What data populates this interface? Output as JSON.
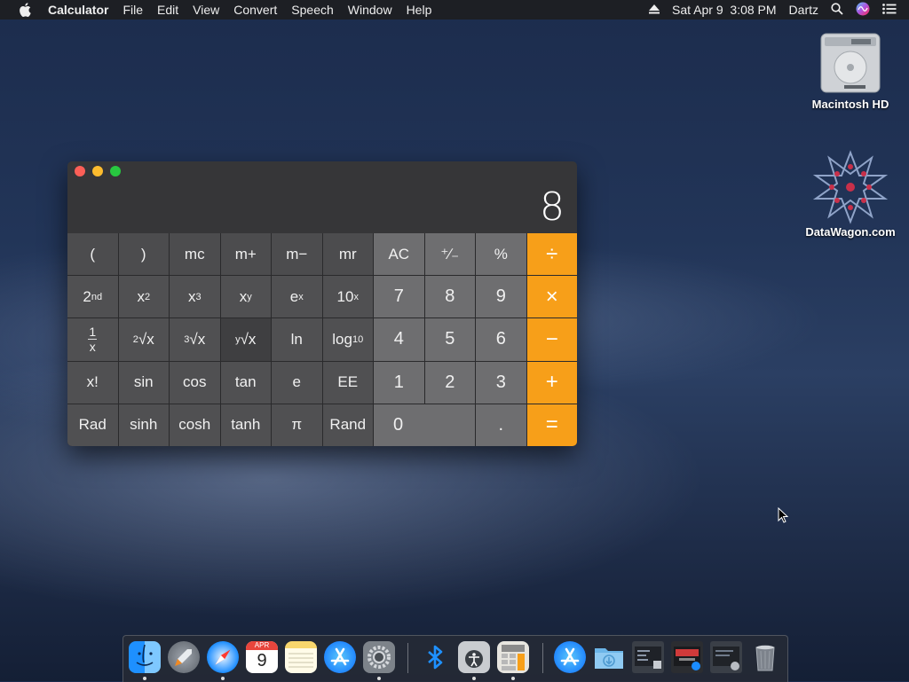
{
  "menubar": {
    "app_name": "Calculator",
    "menus": [
      "File",
      "Edit",
      "View",
      "Convert",
      "Speech",
      "Window",
      "Help"
    ],
    "datetime": "Sat Apr 9  3:08 PM",
    "user": "Dartz"
  },
  "desktop": {
    "icons": [
      {
        "label": "Macintosh HD",
        "icon": "hard-drive-icon"
      },
      {
        "label": "DataWagon.com",
        "icon": "datawagon-logo-icon"
      }
    ]
  },
  "calculator": {
    "display": "8",
    "keys": {
      "row1": [
        "(",
        ")",
        "mc",
        "m+",
        "m−",
        "mr",
        "AC",
        "⁺∕₋",
        "%",
        "÷"
      ],
      "row2": [
        "2",
        "x",
        "x",
        "x",
        "e",
        "10",
        "7",
        "8",
        "9",
        "×"
      ],
      "row2_sup": [
        "nd",
        "2",
        "3",
        "y",
        "x",
        "x"
      ],
      "row3": [
        "x",
        "√x",
        "√x",
        "√x",
        "ln",
        "log",
        "4",
        "5",
        "6",
        "−"
      ],
      "row3_frac_num": "1",
      "row3_root_idx": [
        "2",
        "3",
        "y"
      ],
      "row3_log_sub": "10",
      "row4": [
        "x!",
        "sin",
        "cos",
        "tan",
        "e",
        "EE",
        "1",
        "2",
        "3",
        "+"
      ],
      "row5": [
        "Rad",
        "sinh",
        "cosh",
        "tanh",
        "π",
        "Rand",
        "0",
        ".",
        "="
      ]
    }
  },
  "dock": {
    "apps": [
      "finder-icon",
      "launchpad-icon",
      "safari-icon",
      "calendar-icon",
      "notes-icon",
      "app-store-icon",
      "system-preferences-icon",
      "bluetooth-icon",
      "voiceover-utility-icon",
      "calculator-icon",
      "app-store-download-icon",
      "downloads-folder-icon",
      "screenshot-1-icon",
      "screenshot-2-icon",
      "screenshot-3-icon",
      "trash-icon"
    ],
    "calendar_month": "APR",
    "calendar_day": "9"
  },
  "colors": {
    "operator": "#f79f19",
    "function_key": "#505052",
    "number_key": "#6e6e70",
    "close": "#fc5f57",
    "minimize": "#fdbc2e",
    "zoom": "#28c840"
  }
}
